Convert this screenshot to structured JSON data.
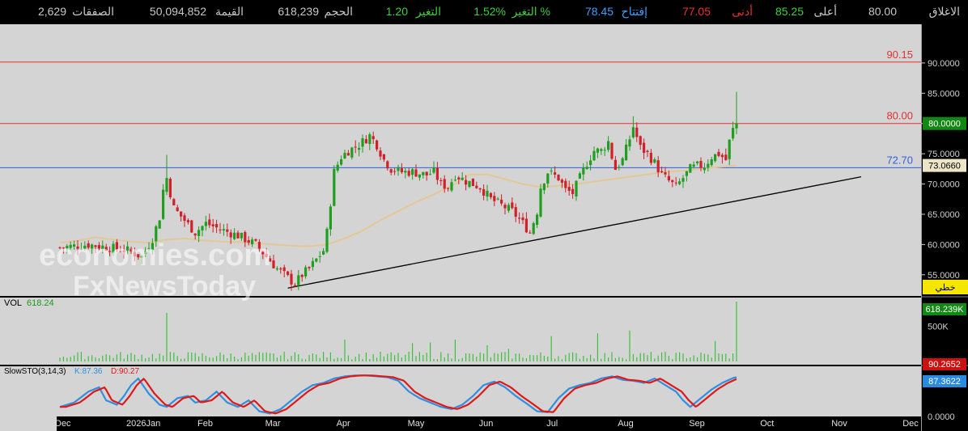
{
  "header": {
    "close_label": "الاغلاق",
    "close_value": "80.00",
    "high_label": "أعلى",
    "high_value": "85.25",
    "low_label": "أدنى",
    "low_value": "77.05",
    "open_label": "إفتتاح",
    "open_value": "78.45",
    "change_pct_label": "التغير %",
    "change_pct_value": "1.52%",
    "change_label": "التغير",
    "change_value": "1.20",
    "volume_label": "الحجم",
    "volume_value": "618,239",
    "value_label": "القيمة",
    "value_value": "50,094,852",
    "trades_label": "الصفقات",
    "trades_value": "2,629"
  },
  "watermark": {
    "line1": "economies.com",
    "line2": "FxNewsToday"
  },
  "colors": {
    "up": "#1f9e1f",
    "down": "#d0202a",
    "ma": "#e3c896",
    "resistance": "#e03030",
    "support": "#3060e0",
    "trendline": "#000000",
    "stoch_k": "#2f8fe0",
    "stoch_d": "#e01818",
    "volume": "#3ac23a"
  },
  "price_panel": {
    "ticks": [
      "90.0000",
      "85.0000",
      "80.0000",
      "75.0000",
      "70.0000",
      "65.0000",
      "60.0000",
      "55.0000"
    ],
    "tick_values": [
      90,
      85,
      80,
      75,
      70,
      65,
      60,
      55
    ],
    "ymin": 51.5,
    "ymax": 96.4,
    "current_price_label": "80.0000",
    "ma_label": "73.0660",
    "scale_label": "خطي",
    "levels": [
      {
        "value": 90.15,
        "label": "90.15",
        "color": "#e03030"
      },
      {
        "value": 80.0,
        "label": "80.00",
        "color": "#e03030"
      },
      {
        "value": 72.7,
        "label": "72.70",
        "color": "#3060e0"
      }
    ]
  },
  "volume_panel": {
    "title": "VOL",
    "value": "618.24",
    "ticks": [
      "500K",
      "0K"
    ],
    "tick_values": [
      500,
      0
    ],
    "max": 850,
    "current_label": "618.239K"
  },
  "stoch_panel": {
    "title": "SlowSTO(3,14,3)",
    "k_text": "K:87.36",
    "d_text": "D:90.27",
    "d_label": "90.2652",
    "k_label": "87.3622",
    "bottom_tick": "0.0000"
  },
  "x_axis": {
    "labels": [
      "Dec",
      "2026Jan",
      "Feb",
      "Mar",
      "Apr",
      "May",
      "Jun",
      "Jul",
      "Aug",
      "Sep",
      "Oct",
      "Nov",
      "Dec"
    ],
    "label_index": [
      0,
      20,
      40,
      59,
      79,
      99,
      119,
      138,
      158,
      178,
      198,
      218,
      238
    ]
  },
  "chart_data": {
    "type": "candlestick",
    "x_start": "Dec",
    "days_per_label": 20,
    "anchors": [
      [
        0,
        59.5
      ],
      [
        8,
        60
      ],
      [
        14,
        59.5
      ],
      [
        19,
        59
      ],
      [
        23,
        58
      ],
      [
        26,
        61
      ],
      [
        28,
        64.5
      ],
      [
        29,
        69
      ],
      [
        30,
        71
      ],
      [
        32,
        66
      ],
      [
        35,
        64
      ],
      [
        38,
        62
      ],
      [
        41,
        63.5
      ],
      [
        45,
        62.5
      ],
      [
        50,
        61.5
      ],
      [
        55,
        60
      ],
      [
        58,
        58
      ],
      [
        61,
        56
      ],
      [
        64,
        54.5
      ],
      [
        66,
        53.5
      ],
      [
        68,
        55
      ],
      [
        70,
        56
      ],
      [
        72,
        57.5
      ],
      [
        74,
        59
      ],
      [
        75,
        62
      ],
      [
        76,
        67
      ],
      [
        77,
        72
      ],
      [
        79,
        74.5
      ],
      [
        81,
        75.5
      ],
      [
        84,
        76.5
      ],
      [
        86,
        77.5
      ],
      [
        87,
        78
      ],
      [
        89,
        76.5
      ],
      [
        91,
        74
      ],
      [
        93,
        72.5
      ],
      [
        96,
        72
      ],
      [
        99,
        72
      ],
      [
        103,
        71.5
      ],
      [
        105,
        72
      ],
      [
        107,
        70
      ],
      [
        109,
        69.5
      ],
      [
        111,
        71.5
      ],
      [
        114,
        70.5
      ],
      [
        116,
        70
      ],
      [
        118,
        69.5
      ],
      [
        121,
        67.5
      ],
      [
        124,
        66.5
      ],
      [
        127,
        65.5
      ],
      [
        130,
        63.5
      ],
      [
        132,
        62
      ],
      [
        134,
        65.5
      ],
      [
        135,
        69.5
      ],
      [
        137,
        72
      ],
      [
        140,
        71
      ],
      [
        142,
        69
      ],
      [
        144,
        68.5
      ],
      [
        146,
        71
      ],
      [
        148,
        73.5
      ],
      [
        150,
        75.5
      ],
      [
        152,
        75.5
      ],
      [
        154,
        77
      ],
      [
        155,
        74.5
      ],
      [
        156,
        72.5
      ],
      [
        158,
        74
      ],
      [
        160,
        77.5
      ],
      [
        161,
        79.5
      ],
      [
        163,
        76
      ],
      [
        165,
        75
      ],
      [
        167,
        73.5
      ],
      [
        169,
        71.5
      ],
      [
        171,
        70.5
      ],
      [
        173,
        69.5
      ],
      [
        175,
        71
      ],
      [
        177,
        72.5
      ],
      [
        179,
        73
      ],
      [
        181,
        73
      ],
      [
        183,
        74.5
      ],
      [
        185,
        75
      ],
      [
        187,
        74
      ],
      [
        188,
        77
      ],
      [
        189,
        79
      ],
      [
        190,
        80
      ]
    ],
    "ma_points": [
      [
        0,
        60.3
      ],
      [
        5,
        60.6
      ],
      [
        10,
        61.2
      ],
      [
        15,
        60.8
      ],
      [
        20,
        60.5
      ],
      [
        25,
        60.3
      ],
      [
        30,
        60.8
      ],
      [
        35,
        61
      ],
      [
        40,
        60.7
      ],
      [
        45,
        60.5
      ],
      [
        50,
        60.4
      ],
      [
        55,
        60.2
      ],
      [
        60,
        60
      ],
      [
        65,
        59.8
      ],
      [
        70,
        59.7
      ],
      [
        75,
        60
      ],
      [
        80,
        61
      ],
      [
        85,
        62.3
      ],
      [
        90,
        64
      ],
      [
        95,
        65.5
      ],
      [
        100,
        67
      ],
      [
        105,
        68.3
      ],
      [
        110,
        69.7
      ],
      [
        115,
        71.5
      ],
      [
        120,
        71.6
      ],
      [
        125,
        70.8
      ],
      [
        130,
        70
      ],
      [
        135,
        69.5
      ],
      [
        140,
        69.7
      ],
      [
        145,
        70
      ],
      [
        150,
        70.4
      ],
      [
        155,
        70.8
      ],
      [
        160,
        71.2
      ],
      [
        165,
        71.6
      ],
      [
        170,
        72
      ],
      [
        175,
        72.2
      ],
      [
        180,
        72.5
      ],
      [
        185,
        72.8
      ],
      [
        190,
        73.07
      ]
    ],
    "trendline": [
      [
        64,
        52.8
      ],
      [
        225,
        71.2
      ]
    ],
    "volume_spikes": [
      [
        30,
        690
      ],
      [
        80,
        310
      ],
      [
        99,
        260
      ],
      [
        104,
        270
      ],
      [
        111,
        310
      ],
      [
        120,
        230
      ],
      [
        126,
        180
      ],
      [
        138,
        360
      ],
      [
        151,
        400
      ],
      [
        160,
        440
      ],
      [
        184,
        290
      ],
      [
        190,
        850
      ]
    ],
    "stoch_anchors": [
      [
        0,
        20
      ],
      [
        4,
        30
      ],
      [
        8,
        55
      ],
      [
        11,
        65
      ],
      [
        13,
        35
      ],
      [
        16,
        25
      ],
      [
        18,
        45
      ],
      [
        20,
        70
      ],
      [
        22,
        85
      ],
      [
        25,
        50
      ],
      [
        28,
        25
      ],
      [
        30,
        20
      ],
      [
        33,
        40
      ],
      [
        36,
        45
      ],
      [
        38,
        30
      ],
      [
        41,
        35
      ],
      [
        44,
        55
      ],
      [
        47,
        30
      ],
      [
        50,
        20
      ],
      [
        53,
        35
      ],
      [
        56,
        10
      ],
      [
        59,
        5
      ],
      [
        62,
        15
      ],
      [
        65,
        35
      ],
      [
        68,
        55
      ],
      [
        71,
        70
      ],
      [
        74,
        75
      ],
      [
        77,
        85
      ],
      [
        80,
        90
      ],
      [
        83,
        92
      ],
      [
        86,
        92
      ],
      [
        89,
        90
      ],
      [
        92,
        88
      ],
      [
        95,
        80
      ],
      [
        98,
        55
      ],
      [
        101,
        40
      ],
      [
        104,
        30
      ],
      [
        107,
        20
      ],
      [
        110,
        15
      ],
      [
        113,
        25
      ],
      [
        116,
        45
      ],
      [
        119,
        70
      ],
      [
        122,
        78
      ],
      [
        125,
        65
      ],
      [
        128,
        45
      ],
      [
        131,
        28
      ],
      [
        134,
        10
      ],
      [
        137,
        8
      ],
      [
        140,
        40
      ],
      [
        143,
        62
      ],
      [
        146,
        70
      ],
      [
        149,
        75
      ],
      [
        152,
        85
      ],
      [
        155,
        90
      ],
      [
        158,
        82
      ],
      [
        161,
        80
      ],
      [
        164,
        75
      ],
      [
        167,
        85
      ],
      [
        170,
        70
      ],
      [
        173,
        55
      ],
      [
        175,
        35
      ],
      [
        177,
        20
      ],
      [
        180,
        40
      ],
      [
        183,
        60
      ],
      [
        186,
        75
      ],
      [
        189,
        86
      ],
      [
        191,
        90
      ]
    ],
    "stoch_d_lag": 1.6
  }
}
